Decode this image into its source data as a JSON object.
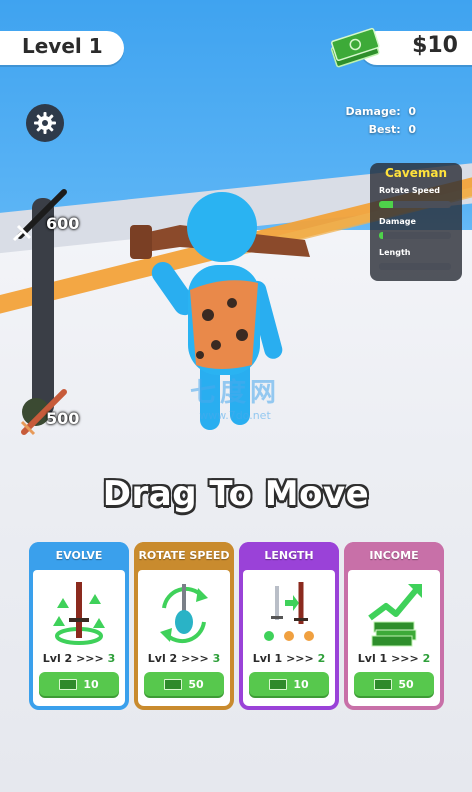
{
  "hud": {
    "level": "Level 1",
    "money": "$10"
  },
  "stats": {
    "damage_label": "Damage:",
    "damage_value": "0",
    "best_label": "Best:",
    "best_value": "0"
  },
  "panel": {
    "title": "Caveman",
    "rows": [
      {
        "label": "Rotate Speed",
        "fill": 0.2
      },
      {
        "label": "Damage",
        "fill": 0.06
      },
      {
        "label": "Length",
        "fill": 0.0
      }
    ]
  },
  "meter": {
    "top_value": "600",
    "bottom_value": "500"
  },
  "prompt": "Drag To Move",
  "watermark": {
    "line1": "七度网",
    "line2": "www.7do.net"
  },
  "cards": [
    {
      "title": "EVOLVE",
      "lvl": "Lvl 2",
      "arrows": ">>>",
      "next": "3",
      "price": "10",
      "head_color": "#3aa0ec",
      "border_color": "#3aa0ec",
      "icon": "sword-evolve-icon"
    },
    {
      "title": "ROTATE SPEED",
      "lvl": "Lvl 2",
      "arrows": ">>>",
      "next": "3",
      "price": "50",
      "head_color": "#c98b2e",
      "border_color": "#c98b2e",
      "icon": "rotate-icon"
    },
    {
      "title": "LENGTH",
      "lvl": "Lvl 1",
      "arrows": ">>>",
      "next": "2",
      "price": "10",
      "head_color": "#9a42d8",
      "border_color": "#9a42d8",
      "icon": "length-icon"
    },
    {
      "title": "INCOME",
      "lvl": "Lvl 1",
      "arrows": ">>>",
      "next": "2",
      "price": "50",
      "head_color": "#c870a8",
      "border_color": "#c870a8",
      "icon": "income-icon"
    }
  ]
}
